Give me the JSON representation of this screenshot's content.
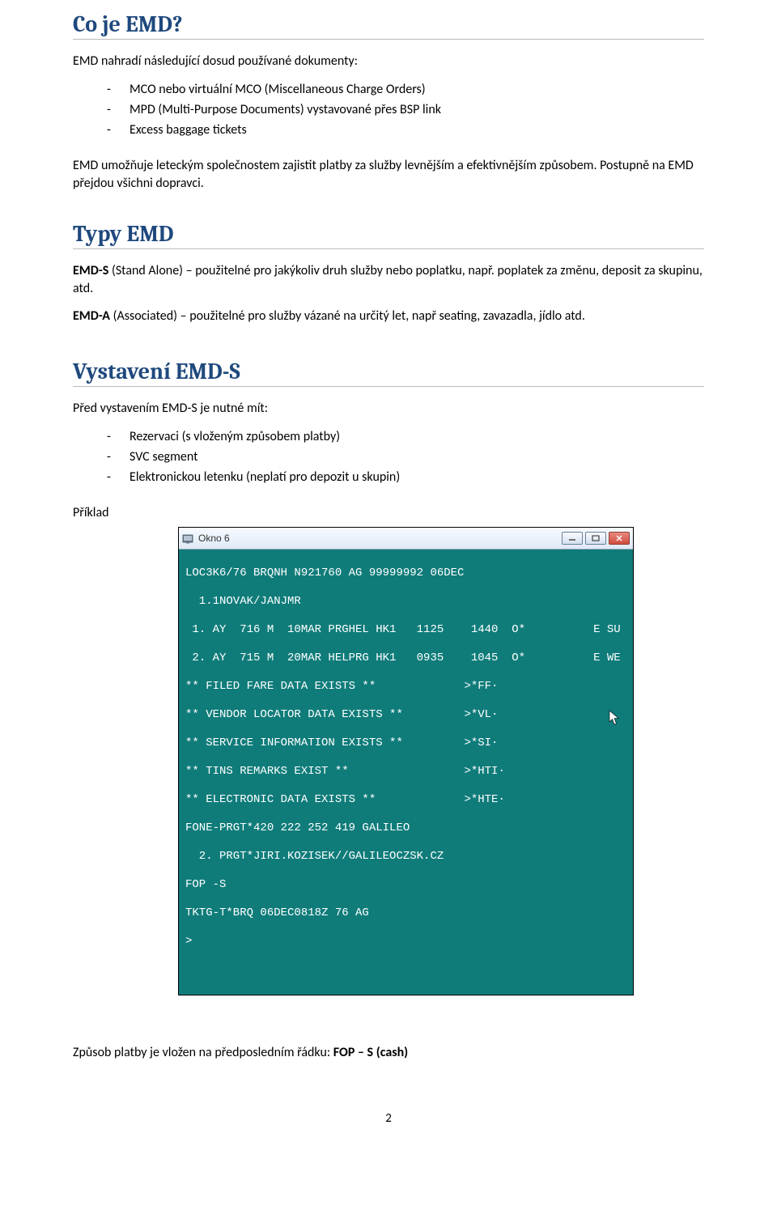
{
  "sec1": {
    "heading": "Co je EMD?",
    "para1": "EMD  nahradí následující dosud používané dokumenty:",
    "items": [
      "MCO nebo virtuální MCO (Miscellaneous Charge Orders)",
      "MPD (Multi-Purpose Documents) vystavované přes BSP link",
      "Excess baggage tickets"
    ],
    "para2": "EMD umožňuje leteckým společnostem zajistit platby za služby levnějším a efektivnějším způsobem. Postupně na EMD přejdou všichni dopravci."
  },
  "sec2": {
    "heading": "Typy EMD",
    "p1a": "EMD-S",
    "p1b": " (Stand Alone) – použitelné pro jakýkoliv druh služby nebo poplatku, např. poplatek za změnu, deposit za skupinu, atd.",
    "p2a": "EMD-A",
    "p2b": " (Associated) – použitelné pro služby vázané na určitý let, např seating, zavazadla, jídlo atd."
  },
  "sec3": {
    "heading": "Vystavení EMD-S",
    "intro": "Před vystavením EMD-S je nutné mít:",
    "items": [
      "Rezervaci (s vloženým způsobem platby)",
      "SVC segment",
      "Elektronickou letenku (neplatí pro depozit u skupin)"
    ],
    "priklad": "Příklad"
  },
  "window": {
    "title": "Okno 6",
    "lines": [
      "LOC3K6/76 BRQNH N921760 AG 99999992 06DEC",
      "  1.1NOVAK/JANJMR",
      " 1. AY  716 M  10MAR PRGHEL HK1   1125    1440  O*          E SU",
      " 2. AY  715 M  20MAR HELPRG HK1   0935    1045  O*          E WE",
      "** FILED FARE DATA EXISTS **             >*FF·",
      "** VENDOR LOCATOR DATA EXISTS **         >*VL·",
      "** SERVICE INFORMATION EXISTS **         >*SI·",
      "** TINS REMARKS EXIST **                 >*HTI·",
      "** ELECTRONIC DATA EXISTS **             >*HTE·",
      "FONE-PRGT*420 222 252 419 GALILEO",
      "  2. PRGT*JIRI.KOZISEK//GALILEOCZSK.CZ",
      "FOP -S",
      "TKTG-T*BRQ 06DEC0818Z 76 AG",
      ">"
    ]
  },
  "closing_a": "Způsob platby je vložen na předposledním řádku: ",
  "closing_b": "FOP – S (cash)",
  "pagenum": "2"
}
